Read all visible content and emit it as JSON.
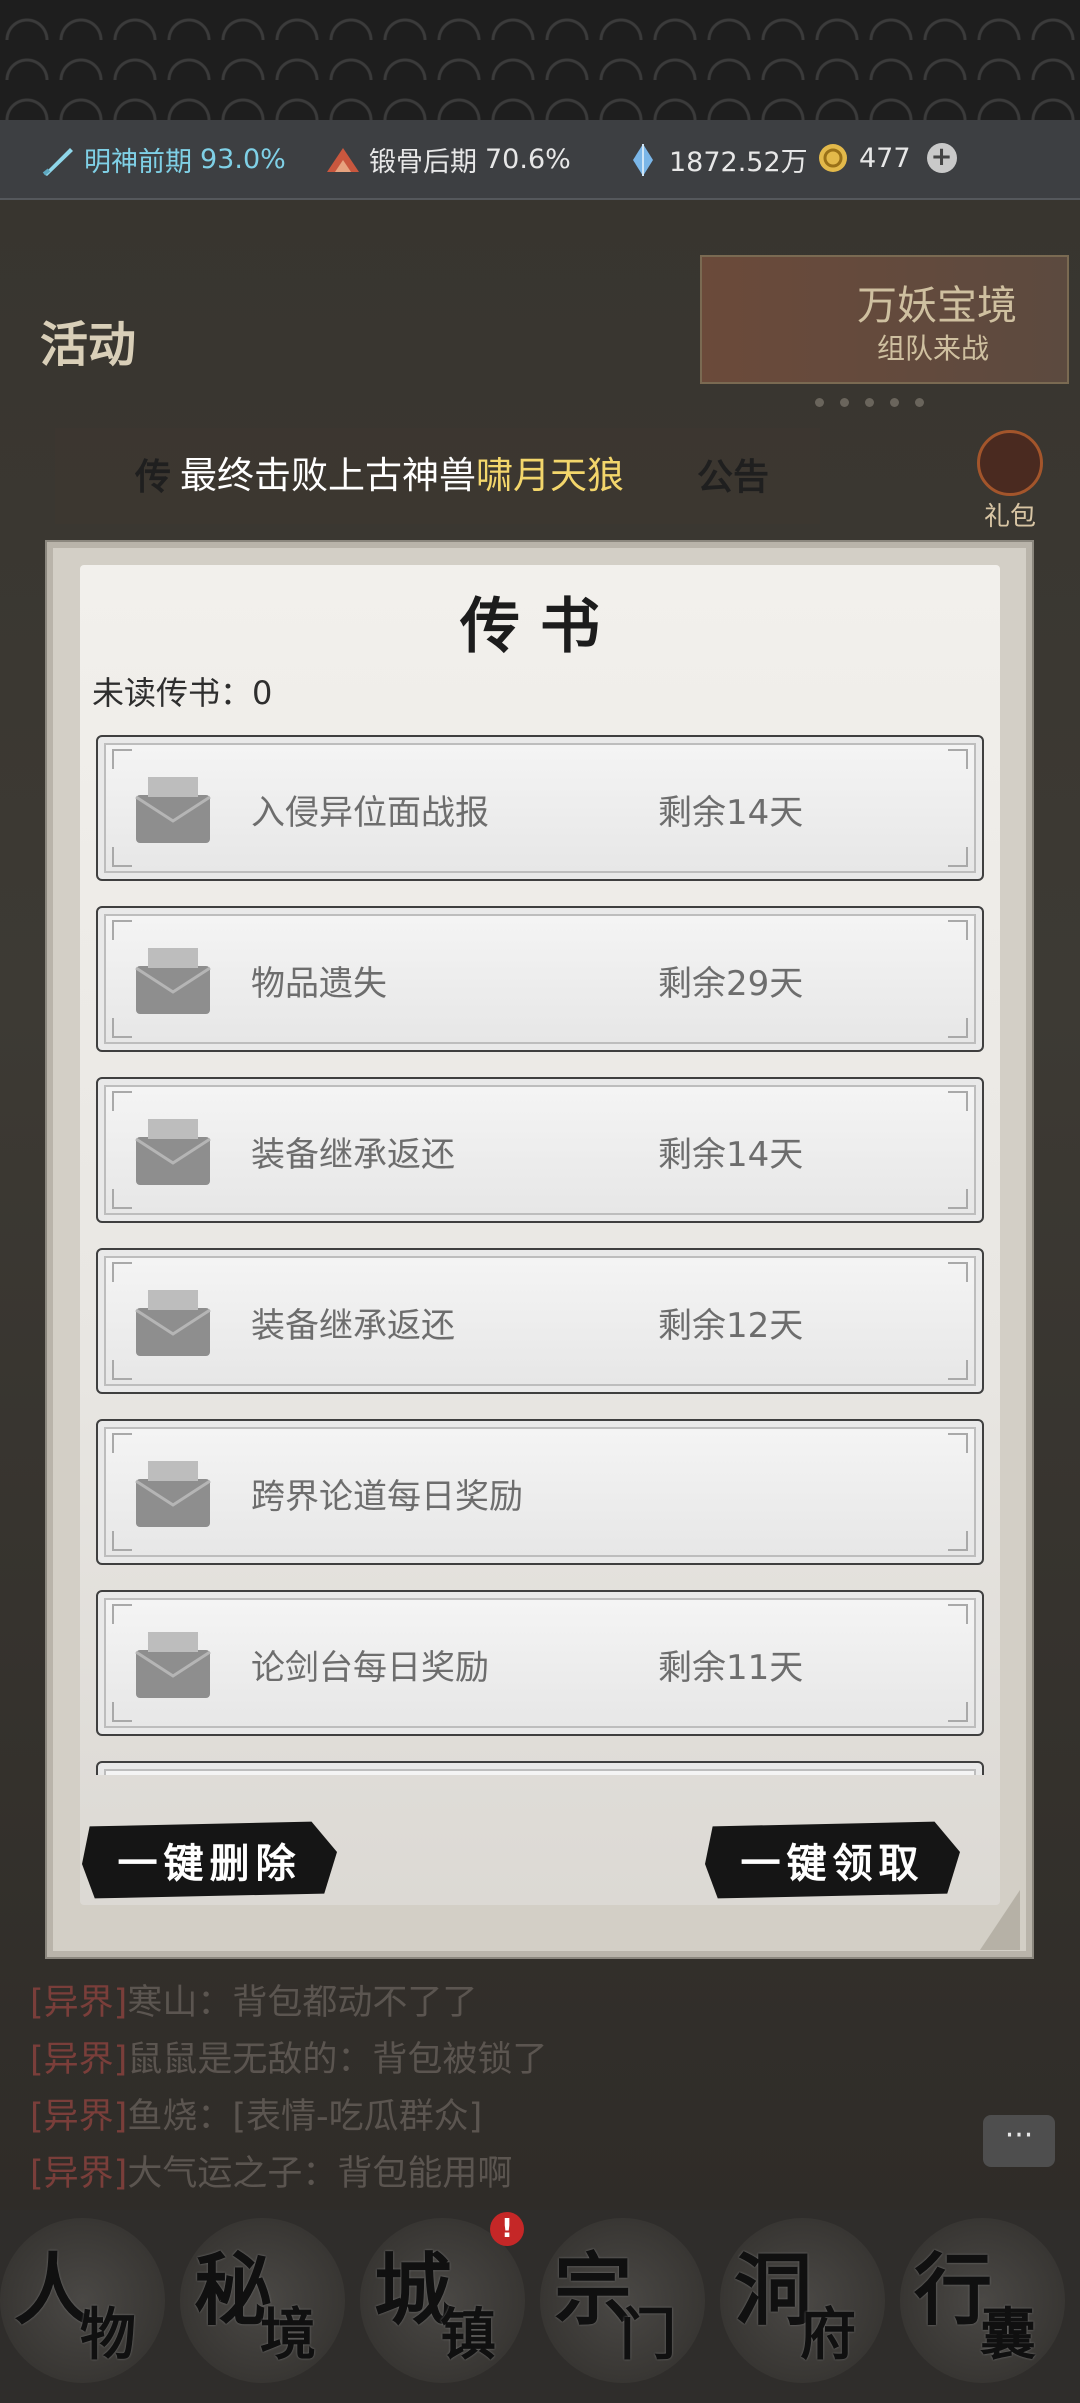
{
  "status_bar": {
    "cultivation": "明神前期",
    "cultivation_pct": "93.0%",
    "body_refine": "锻骨后期",
    "body_refine_pct": "70.6%",
    "spirit_stones": "1872.52万",
    "gold": "477",
    "add_icon": "plus-icon"
  },
  "background": {
    "activity_label": "活动",
    "event_title": "万妖宝境",
    "event_sub": "组队来战",
    "gift_label": "礼包"
  },
  "announcement": {
    "prefix": "最终击败上古神兽",
    "highlight": "啸月天狼",
    "tab_left": "传",
    "tab_right": "公告"
  },
  "modal": {
    "title": "传书",
    "unread_label": "未读传书：0",
    "mails": [
      {
        "name": "入侵异位面战报",
        "remain": "剩余14天"
      },
      {
        "name": "物品遗失",
        "remain": "剩余29天"
      },
      {
        "name": "装备继承返还",
        "remain": "剩余14天"
      },
      {
        "name": "装备继承返还",
        "remain": "剩余12天"
      },
      {
        "name": "跨界论道每日奖励",
        "remain": ""
      },
      {
        "name": "论剑台每日奖励",
        "remain": "剩余11天"
      }
    ],
    "delete_all": "一键删除",
    "claim_all": "一键领取"
  },
  "chat": [
    {
      "tag": "[异界]",
      "user": "寒山",
      "msg": "：背包都动不了了"
    },
    {
      "tag": "[异界]",
      "user": "鼠鼠是无敌的",
      "msg": "：背包被锁了"
    },
    {
      "tag": "[异界]",
      "user": "鱼烧",
      "msg": "：[表情-吃瓜群众]"
    },
    {
      "tag": "[异界]",
      "user": "大气运之子",
      "msg": "：背包能用啊"
    }
  ],
  "chat_button": "···",
  "nav": [
    {
      "c1": "人",
      "c2": "物"
    },
    {
      "c1": "秘",
      "c2": "境"
    },
    {
      "c1": "城",
      "c2": "镇"
    },
    {
      "c1": "宗",
      "c2": "门"
    },
    {
      "c1": "洞",
      "c2": "府"
    },
    {
      "c1": "行",
      "c2": "囊"
    }
  ],
  "nav_badge": "!"
}
